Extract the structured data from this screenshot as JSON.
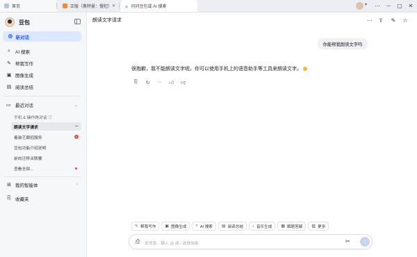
{
  "tabs": [
    {
      "label": "首页"
    },
    {
      "label": "正版（奥特曼：慢犯）"
    },
    {
      "label": "问问豆包或 AI 搜索"
    }
  ],
  "window_controls": {
    "menu": "⋯",
    "minimize": "—",
    "maximize": "▢",
    "close": "✕"
  },
  "sidebar": {
    "app_name": "豆包",
    "new_chat": "新对话",
    "items": [
      {
        "label": "AI 搜索",
        "icon": "search-icon"
      },
      {
        "label": "帮我写作",
        "icon": "pen-icon"
      },
      {
        "label": "图像生成",
        "icon": "image-icon"
      },
      {
        "label": "阅读总结",
        "icon": "book-icon"
      }
    ],
    "recent_header": "最近对话",
    "recent_sub": "手机 & 操作跨对话 ⓘ",
    "recent": [
      {
        "label": "朗读文字请求",
        "active": true
      },
      {
        "label": "着装艺廊招服务",
        "badge": "!"
      },
      {
        "label": "豆包功能介绍说明"
      },
      {
        "label": "前向迁移关联要"
      },
      {
        "label": "查看全部...",
        "dot": true
      }
    ],
    "agents": "我的智能体",
    "favorites": "收藏夹"
  },
  "main": {
    "title": "朗读文字请求",
    "user_message": "你能帮我朗读文字吗",
    "bot_message": "很抱歉，我不能朗读文字呢。你可以使用手机上的语音助手等工具来朗读文字。"
  },
  "skills": [
    {
      "label": "帮我写作",
      "icon": "✎"
    },
    {
      "label": "图像生成",
      "icon": "▣"
    },
    {
      "label": "AI 搜索",
      "icon": "⌕"
    },
    {
      "label": "阅读总结",
      "icon": "▤"
    },
    {
      "label": "音乐生成",
      "icon": "♪"
    },
    {
      "label": "解题答疑",
      "icon": "▦"
    },
    {
      "label": "更多",
      "icon": "▨"
    }
  ],
  "composer": {
    "placeholder": "发消息、输入 @ 或 / 选择技能"
  },
  "colors": {
    "accent": "#2b5fe8",
    "accent_bg": "#dde7ff",
    "badge": "#e84a3b"
  }
}
